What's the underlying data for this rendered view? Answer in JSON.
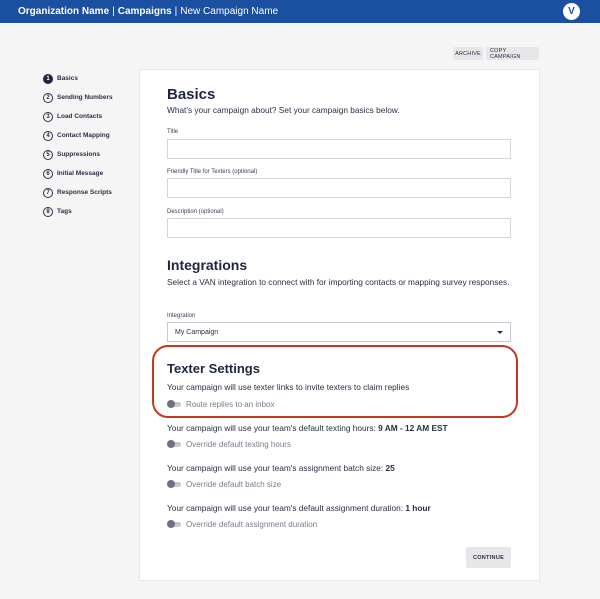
{
  "header": {
    "org": "Organization Name",
    "separator": "|",
    "section": "Campaigns",
    "campaign": "New Campaign Name",
    "avatar": "V"
  },
  "actions": {
    "archive": "ARCHIVE",
    "copy": "COPY CAMPAIGN"
  },
  "steps": [
    {
      "num": "1",
      "label": "Basics"
    },
    {
      "num": "2",
      "label": "Sending Numbers"
    },
    {
      "num": "3",
      "label": "Load Contacts"
    },
    {
      "num": "4",
      "label": "Contact Mapping"
    },
    {
      "num": "5",
      "label": "Suppressions"
    },
    {
      "num": "6",
      "label": "Initial Message"
    },
    {
      "num": "7",
      "label": "Response Scripts"
    },
    {
      "num": "8",
      "label": "Tags"
    }
  ],
  "basics": {
    "title": "Basics",
    "subtitle": "What's your campaign about? Set your campaign basics below.",
    "fields": {
      "title": "Title",
      "friendly": "Friendly Title for Texters (optional)",
      "description": "Description (optional)"
    }
  },
  "integrations": {
    "title": "Integrations",
    "subtitle": "Select a VAN integration to connect with for importing contacts or mapping survey responses.",
    "label": "Integration",
    "value": "My Campaign"
  },
  "texter": {
    "title": "Texter Settings",
    "subtitle": "Your campaign will use texter links to invite texters to claim replies",
    "route": "Route replies to an inbox"
  },
  "hours": {
    "text": "Your campaign will use your team's default texting hours:",
    "value": "9 AM - 12 AM EST",
    "toggle": "Override default texting hours"
  },
  "batch": {
    "text": "Your campaign will use your team's assignment batch size:",
    "value": "25",
    "toggle": "Override default batch size"
  },
  "duration": {
    "text": "Your campaign will use your team's default assignment duration:",
    "value": "1 hour",
    "toggle": "Override default assignment duration"
  },
  "continue_label": "CONTINUE",
  "colors": {
    "header": "#1b4fa0",
    "highlight": "#c4391d"
  }
}
